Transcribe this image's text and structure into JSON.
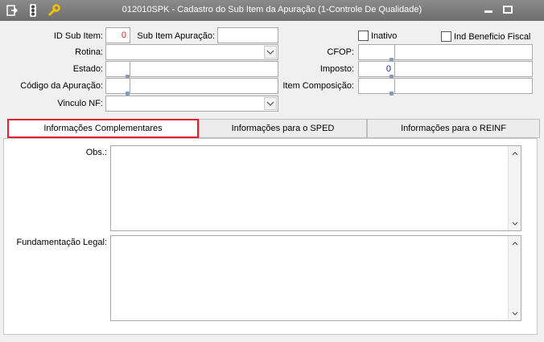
{
  "window": {
    "title": "012010SPK - Cadastro do Sub Item da Apuração (1-Controle De Qualidade)"
  },
  "form": {
    "id_sub_item": {
      "label": "ID Sub Item:",
      "value": "0"
    },
    "sub_item_apuracao": {
      "label": "Sub Item Apuração:",
      "value": ""
    },
    "inativo": {
      "label": "Inativo"
    },
    "ind_beneficio_fiscal": {
      "label": "Ind Beneficio Fiscal"
    },
    "rotina": {
      "label": "Rotina:",
      "value": ""
    },
    "cfop": {
      "label": "CFOP:",
      "value": ""
    },
    "estado": {
      "label": "Estado:",
      "value": ""
    },
    "imposto": {
      "label": "Imposto:",
      "value": "0"
    },
    "codigo_apuracao": {
      "label": "Código da Apuração:",
      "value": ""
    },
    "item_composicao": {
      "label": "Item Composição:",
      "value": ""
    },
    "vinculo_nf": {
      "label": "Vinculo NF:",
      "value": ""
    }
  },
  "tabs": [
    {
      "label": "Informações Complementares"
    },
    {
      "label": "Informações para o SPED"
    },
    {
      "label": "Informações para o REINF"
    }
  ],
  "panel": {
    "obs_label": "Obs.:",
    "fundamentacao_label": "Fundamentação Legal:"
  },
  "colors": {
    "accent": "#e0212d",
    "titlebar": "#7d7d7d",
    "id_value": "#e0212d",
    "imposto_value": "#1a1aa6"
  }
}
